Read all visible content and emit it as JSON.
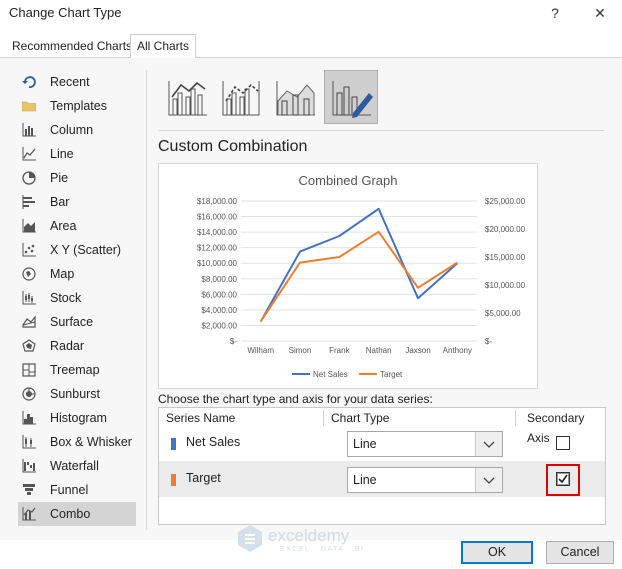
{
  "window": {
    "title": "Change Chart Type",
    "help_glyph": "?",
    "close_glyph": "✕"
  },
  "tabs": [
    {
      "label": "Recommended Charts"
    },
    {
      "label": "All Charts",
      "active": true
    }
  ],
  "nav": {
    "items": [
      {
        "label": "Recent",
        "icon": "recent-icon"
      },
      {
        "label": "Templates",
        "icon": "folder-icon"
      },
      {
        "label": "Column",
        "icon": "column-chart-icon"
      },
      {
        "label": "Line",
        "icon": "line-chart-icon"
      },
      {
        "label": "Pie",
        "icon": "pie-chart-icon"
      },
      {
        "label": "Bar",
        "icon": "bar-chart-icon"
      },
      {
        "label": "Area",
        "icon": "area-chart-icon"
      },
      {
        "label": "X Y (Scatter)",
        "icon": "scatter-chart-icon"
      },
      {
        "label": "Map",
        "icon": "map-icon"
      },
      {
        "label": "Stock",
        "icon": "stock-chart-icon"
      },
      {
        "label": "Surface",
        "icon": "surface-chart-icon"
      },
      {
        "label": "Radar",
        "icon": "radar-chart-icon"
      },
      {
        "label": "Treemap",
        "icon": "treemap-icon"
      },
      {
        "label": "Sunburst",
        "icon": "sunburst-icon"
      },
      {
        "label": "Histogram",
        "icon": "histogram-icon"
      },
      {
        "label": "Box & Whisker",
        "icon": "box-whisker-icon"
      },
      {
        "label": "Waterfall",
        "icon": "waterfall-icon"
      },
      {
        "label": "Funnel",
        "icon": "funnel-icon"
      },
      {
        "label": "Combo",
        "icon": "combo-chart-icon",
        "selected": true
      }
    ]
  },
  "subtypes": [
    {
      "icon": "clustered-column-line-icon",
      "selected": false
    },
    {
      "icon": "clustered-column-line-secondary-icon",
      "selected": false
    },
    {
      "icon": "stacked-area-column-icon",
      "selected": false
    },
    {
      "icon": "custom-combination-icon",
      "selected": true
    }
  ],
  "section_title": "Custom Combination",
  "chart_data": {
    "type": "line",
    "title": "Combined Graph",
    "categories": [
      "Wilham",
      "Simon",
      "Frank",
      "Nathan",
      "Jaxson",
      "Anthony"
    ],
    "series": [
      {
        "name": "Net Sales",
        "color": "#4472c4",
        "axis": "primary",
        "values": [
          2500,
          11500,
          13500,
          17000,
          5500,
          10000
        ]
      },
      {
        "name": "Target",
        "color": "#ed7d31",
        "axis": "secondary",
        "values": [
          3500,
          14000,
          15000,
          19500,
          9500,
          14000
        ]
      }
    ],
    "y_ticks": [
      "$18,000.00",
      "$16,000.00",
      "$14,000.00",
      "$12,000.00",
      "$10,000.00",
      "$8,000.00",
      "$6,000.00",
      "$4,000.00",
      "$2,000.00",
      "$-"
    ],
    "y2_ticks": [
      "$25,000.00",
      "$20,000.00",
      "$15,000.00",
      "$10,000.00",
      "$5,000.00",
      "$-"
    ],
    "ylim": [
      0,
      18000
    ],
    "y2lim": [
      0,
      25000
    ],
    "grid": true,
    "legend": "bottom"
  },
  "choose_text": "Choose the chart type and axis for your data series:",
  "table": {
    "headers": {
      "name": "Series Name",
      "type": "Chart Type",
      "axis": "Secondary Axis"
    },
    "rows": [
      {
        "name": "Net Sales",
        "color": "#4472c4",
        "chart_type": "Line",
        "secondary": false
      },
      {
        "name": "Target",
        "color": "#ed7d31",
        "chart_type": "Line",
        "secondary": true
      }
    ]
  },
  "buttons": {
    "ok": "OK",
    "cancel": "Cancel"
  },
  "watermark": {
    "name": "exceldemy",
    "tagline": "EXCEL · DATA · BI"
  }
}
